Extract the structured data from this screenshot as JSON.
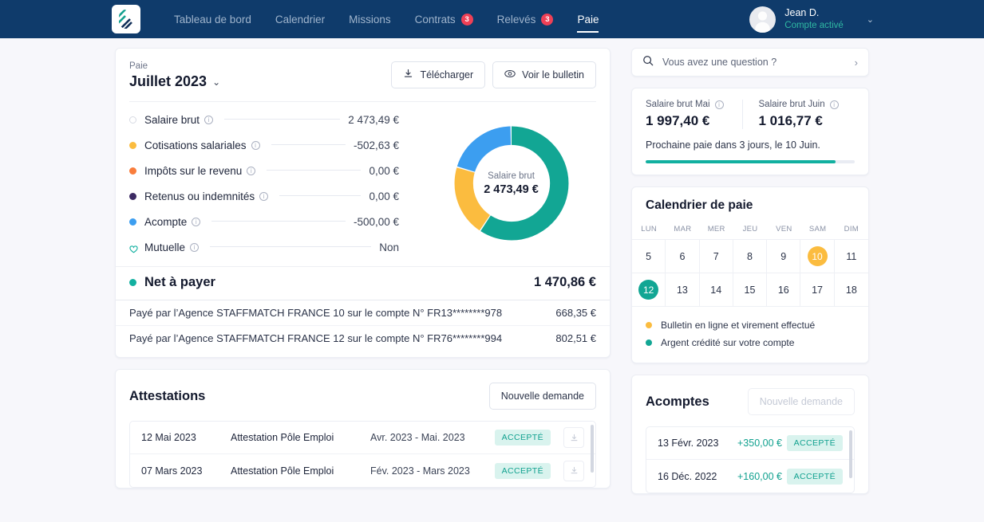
{
  "nav": {
    "logo_name": "staffmatch-logo",
    "links": [
      {
        "label": "Tableau de bord",
        "badge": "",
        "active": false
      },
      {
        "label": "Calendrier",
        "badge": "",
        "active": false
      },
      {
        "label": "Missions",
        "badge": "",
        "active": false
      },
      {
        "label": "Contrats",
        "badge": "3",
        "active": false
      },
      {
        "label": "Relevés",
        "badge": "3",
        "active": false
      },
      {
        "label": "Paie",
        "badge": "",
        "active": true
      }
    ],
    "user": {
      "name": "Jean D.",
      "status": "Compte activé",
      "chevron": "⌄"
    }
  },
  "paie": {
    "label": "Paie",
    "month": "Juillet 2023",
    "chevron": "⌄",
    "download_label": "Télécharger",
    "view_label": "Voir le bulletin",
    "rows": [
      {
        "name": "Salaire brut",
        "value": "2 473,49 €",
        "color": "#ffffff",
        "style": "ring"
      },
      {
        "name": "Cotisations salariales",
        "value": "-502,63 €",
        "color": "#fbbc3f",
        "style": "solid"
      },
      {
        "name": "Impôts sur le revenu",
        "value": "0,00 €",
        "color": "#f97d3c",
        "style": "solid"
      },
      {
        "name": "Retenus ou indemnités",
        "value": "0,00 €",
        "color": "#3c2a63",
        "style": "solid"
      },
      {
        "name": "Acompte",
        "value": "-500,00 €",
        "color": "#3c9ef0",
        "style": "solid"
      },
      {
        "name": "Mutuelle",
        "value": "Non",
        "color": "#12b0a0",
        "style": "heart"
      }
    ],
    "net_label": "Net à payer",
    "net_value": "1 470,86 €",
    "net_color": "#12b0a0",
    "payments": [
      {
        "text": "Payé par l’Agence STAFFMATCH FRANCE 10 sur le compte N° FR13********978",
        "amount": "668,35 €"
      },
      {
        "text": "Payé par l’Agence STAFFMATCH FRANCE 12 sur le compte N° FR76********994",
        "amount": "802,51 €"
      }
    ]
  },
  "chart_data": {
    "type": "pie",
    "title": "Salaire brut",
    "center_label": "Salaire brut",
    "center_value": "2 473,49 €",
    "categories": [
      "Net à payer",
      "Cotisations salariales",
      "Acompte"
    ],
    "values": [
      1470.86,
      502.63,
      500.0
    ],
    "colors": [
      "#12a694",
      "#fbbc3f",
      "#3c9ef0"
    ],
    "total": 2473.49,
    "legend_position": "left-list"
  },
  "search": {
    "placeholder": "Vous avez une question ?",
    "value": "",
    "arrow": "›"
  },
  "salary_summary": {
    "left": {
      "label": "Salaire brut Mai",
      "amount": "1 997,40 €"
    },
    "right": {
      "label": "Salaire brut Juin",
      "amount": "1 016,77 €"
    },
    "next_pay": "Prochaine paie dans 3 jours, le 10 Juin.",
    "progress_percent": 91,
    "progress_color": "#12b0a0"
  },
  "calendar": {
    "title": "Calendrier de paie",
    "dow": [
      "LUN",
      "MAR",
      "MER",
      "JEU",
      "VEN",
      "SAM",
      "DIM"
    ],
    "days": [
      {
        "n": "5",
        "hl": ""
      },
      {
        "n": "6",
        "hl": ""
      },
      {
        "n": "7",
        "hl": ""
      },
      {
        "n": "8",
        "hl": ""
      },
      {
        "n": "9",
        "hl": ""
      },
      {
        "n": "10",
        "hl": "amber"
      },
      {
        "n": "11",
        "hl": ""
      },
      {
        "n": "12",
        "hl": "teal"
      },
      {
        "n": "13",
        "hl": ""
      },
      {
        "n": "14",
        "hl": ""
      },
      {
        "n": "15",
        "hl": ""
      },
      {
        "n": "16",
        "hl": ""
      },
      {
        "n": "17",
        "hl": ""
      },
      {
        "n": "18",
        "hl": ""
      }
    ],
    "legend": [
      {
        "text": "Bulletin en ligne et virement effectué",
        "color": "#fbbc3f"
      },
      {
        "text": "Argent crédité sur votre compte",
        "color": "#12a694"
      }
    ]
  },
  "attestations": {
    "title": "Attestations",
    "new_request_label": "Nouvelle demande",
    "rows": [
      {
        "date": "12 Mai 2023",
        "type": "Attestation Pôle Emploi",
        "range": "Avr. 2023 - Mai. 2023",
        "status": "ACCEPTÉ"
      },
      {
        "date": "07 Mars 2023",
        "type": "Attestation Pôle Emploi",
        "range": "Fév. 2023 - Mars 2023",
        "status": "ACCEPTÉ"
      }
    ]
  },
  "acomptes": {
    "title": "Acomptes",
    "new_request_label": "Nouvelle demande",
    "new_request_disabled": true,
    "rows": [
      {
        "date": "13 Févr. 2023",
        "amount": "+350,00 €",
        "status": "ACCEPTÉ"
      },
      {
        "date": "16 Déc. 2022",
        "amount": "+160,00 €",
        "status": "ACCEPTÉ"
      }
    ]
  }
}
